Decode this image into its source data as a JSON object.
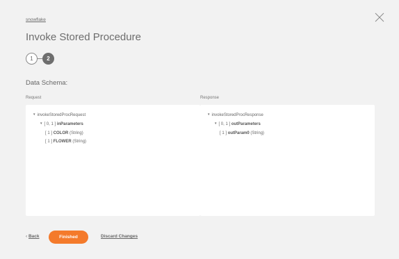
{
  "breadcrumb": "snowflake",
  "title": "Invoke Stored Procedure",
  "steps": [
    "1",
    "2"
  ],
  "active_step": 2,
  "section_title": "Data Schema:",
  "request": {
    "label": "Request",
    "root": "invokeStoredProcRequest",
    "group_card": "[ 0, 1 ]",
    "group_name": "inParameters",
    "fields": [
      {
        "card": "[ 1 ]",
        "name": "COLOR",
        "type": "(String)"
      },
      {
        "card": "[ 1 ]",
        "name": "FLOWER",
        "type": "(String)"
      }
    ]
  },
  "response": {
    "label": "Response",
    "root": "invokeStoredProcResponse",
    "group_card": "[ 0, 1 ]",
    "group_name": "outParameters",
    "fields": [
      {
        "card": "[ 1 ]",
        "name": "outParam0",
        "type": "(String)"
      }
    ]
  },
  "footer": {
    "back_label": "Back",
    "finished_label": "Finished",
    "discard_label": "Discard Changes"
  },
  "colors": {
    "accent": "#f47a2b",
    "background": "#f2f2f2",
    "panel": "#ffffff"
  }
}
